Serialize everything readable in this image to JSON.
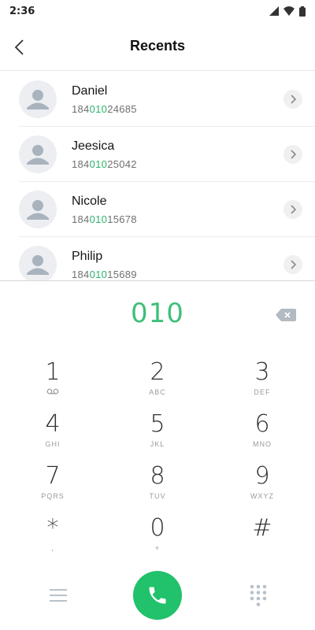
{
  "status": {
    "time": "2:36"
  },
  "header": {
    "title": "Recents"
  },
  "contacts": [
    {
      "name": "Daniel",
      "number_pre": "184",
      "number_match": "010",
      "number_post": "24685"
    },
    {
      "name": "Jeesica",
      "number_pre": "184",
      "number_match": "010",
      "number_post": "25042"
    },
    {
      "name": "Nicole",
      "number_pre": "184",
      "number_match": "010",
      "number_post": "15678"
    },
    {
      "name": "Philip",
      "number_pre": "184",
      "number_match": "010",
      "number_post": "15689"
    }
  ],
  "dialer": {
    "dialed": "010",
    "keys": [
      {
        "digit": "1",
        "letters": ""
      },
      {
        "digit": "2",
        "letters": "ABC"
      },
      {
        "digit": "3",
        "letters": "DEF"
      },
      {
        "digit": "4",
        "letters": "GHI"
      },
      {
        "digit": "5",
        "letters": "JKL"
      },
      {
        "digit": "6",
        "letters": "MNO"
      },
      {
        "digit": "7",
        "letters": "PQRS"
      },
      {
        "digit": "8",
        "letters": "TUV"
      },
      {
        "digit": "9",
        "letters": "WXYZ"
      },
      {
        "digit": "*",
        "letters": ","
      },
      {
        "digit": "0",
        "letters": "+"
      },
      {
        "digit": "#",
        "letters": ""
      }
    ]
  },
  "colors": {
    "accent": "#2db36a",
    "call_button": "#22c16b"
  },
  "icons": {
    "back": "chevron-left-icon",
    "backspace": "backspace-icon",
    "voicemail": "voicemail-icon",
    "call": "phone-icon",
    "menu": "menu-icon",
    "dialpad": "dialpad-icon"
  }
}
